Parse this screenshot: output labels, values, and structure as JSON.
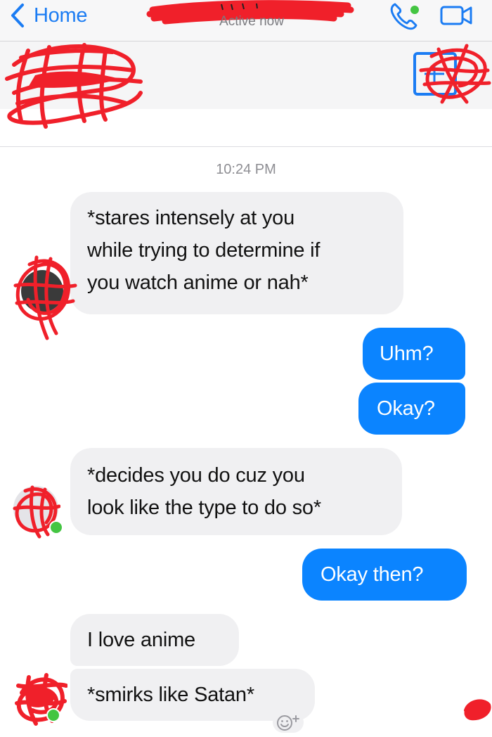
{
  "nav": {
    "back_label": "Home",
    "status": "Active now",
    "accent_color": "#1b7cf3"
  },
  "conversation": {
    "timestamp": "10:24 PM",
    "messages": [
      {
        "from": "them",
        "lines": [
          "*stares intensely at you",
          "while trying to determine if",
          "you watch anime or nah*"
        ]
      },
      {
        "from": "me",
        "lines": [
          "Uhm?"
        ]
      },
      {
        "from": "me",
        "lines": [
          "Okay?"
        ]
      },
      {
        "from": "them",
        "lines": [
          "*decides you do cuz you",
          "look like the type to do so*"
        ]
      },
      {
        "from": "me",
        "lines": [
          "Okay then?"
        ]
      },
      {
        "from": "them",
        "lines": [
          "I love anime"
        ]
      },
      {
        "from": "them",
        "lines": [
          "*smirks like Satan*"
        ]
      }
    ]
  },
  "colors": {
    "outgoing_bubble": "#0b84ff",
    "incoming_bubble": "#f0f0f2",
    "online_dot": "#44c542",
    "redaction_scribble": "#f0202a"
  },
  "icons": {
    "back": "chevron-left-icon",
    "call": "phone-icon",
    "video": "video-camera-icon",
    "react": "emoji-plus-icon"
  }
}
